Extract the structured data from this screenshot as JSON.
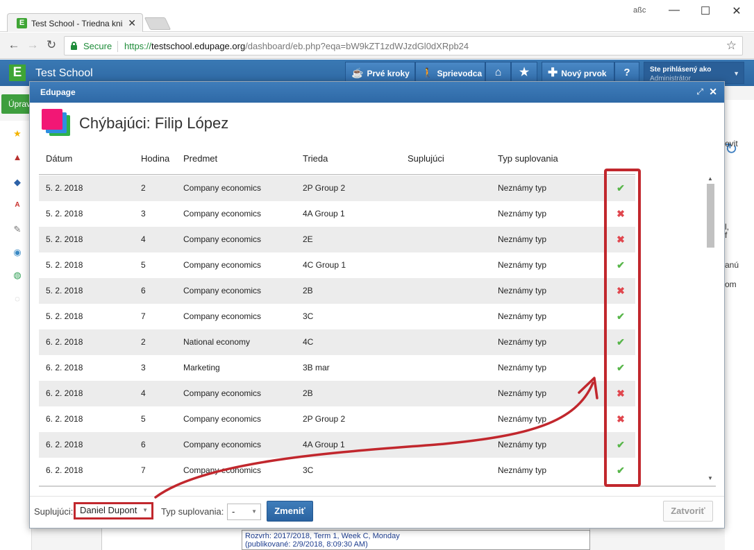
{
  "browser": {
    "tab_title": "Test School - Triedna knižka",
    "tab_favicon": "E",
    "profile_badge": "aßc",
    "secure_label": "Secure",
    "url_scheme": "https://",
    "url_host": "testschool.edupage.org",
    "url_path": "/dashboard/eb.php?eqa=bW9kZT1zdWJzdGl0dXRpb24",
    "icons": [
      "back-arrow-icon",
      "forward-arrow-icon",
      "reload-icon",
      "lock-icon",
      "bookmark-star-icon",
      "close-icon",
      "minimize-icon",
      "maximize-icon"
    ]
  },
  "app": {
    "logo": "E",
    "title": "Test School",
    "buttons": {
      "first_steps": "Prvé kroky",
      "guide": "Sprievodca",
      "new_item": "Nový prvok",
      "help": "?"
    },
    "user": {
      "line1": "Ste prihlásený ako",
      "line2": "Administrátor"
    }
  },
  "background": {
    "upr_button": "Úprav",
    "right_texts": [
      "ovit",
      "l,",
      "f",
      "anú",
      "om"
    ],
    "rozvrh_line1": "Rozvrh: 2017/2018, Term 1, Week C, Monday",
    "rozvrh_line2": "(publikované: 2/9/2018, 8:09:30 AM)"
  },
  "modal": {
    "title": "Edupage",
    "heading": "Chýbajúci: Filip López",
    "columns": {
      "date": "Dátum",
      "lesson": "Hodina",
      "subject": "Predmet",
      "class": "Trieda",
      "substitute": "Suplujúci",
      "type": "Typ suplovania"
    },
    "rows": [
      {
        "date": "5. 2. 2018",
        "lesson": "2",
        "subject": "Company economics",
        "class": "2P Group 2",
        "substitute": "",
        "type": "Neznámy typ",
        "status": "ok"
      },
      {
        "date": "5. 2. 2018",
        "lesson": "3",
        "subject": "Company economics",
        "class": "4A Group 1",
        "substitute": "",
        "type": "Neznámy typ",
        "status": "no"
      },
      {
        "date": "5. 2. 2018",
        "lesson": "4",
        "subject": "Company economics",
        "class": "2E",
        "substitute": "",
        "type": "Neznámy typ",
        "status": "no"
      },
      {
        "date": "5. 2. 2018",
        "lesson": "5",
        "subject": "Company economics",
        "class": "4C Group 1",
        "substitute": "",
        "type": "Neznámy typ",
        "status": "ok"
      },
      {
        "date": "5. 2. 2018",
        "lesson": "6",
        "subject": "Company economics",
        "class": "2B",
        "substitute": "",
        "type": "Neznámy typ",
        "status": "no"
      },
      {
        "date": "5. 2. 2018",
        "lesson": "7",
        "subject": "Company economics",
        "class": "3C",
        "substitute": "",
        "type": "Neznámy typ",
        "status": "ok"
      },
      {
        "date": "6. 2. 2018",
        "lesson": "2",
        "subject": "National economy",
        "class": "4C",
        "substitute": "",
        "type": "Neznámy typ",
        "status": "ok"
      },
      {
        "date": "6. 2. 2018",
        "lesson": "3",
        "subject": "Marketing",
        "class": "3B mar",
        "substitute": "",
        "type": "Neznámy typ",
        "status": "ok"
      },
      {
        "date": "6. 2. 2018",
        "lesson": "4",
        "subject": "Company economics",
        "class": "2B",
        "substitute": "",
        "type": "Neznámy typ",
        "status": "no"
      },
      {
        "date": "6. 2. 2018",
        "lesson": "5",
        "subject": "Company economics",
        "class": "2P Group 2",
        "substitute": "",
        "type": "Neznámy typ",
        "status": "no"
      },
      {
        "date": "6. 2. 2018",
        "lesson": "6",
        "subject": "Company economics",
        "class": "4A Group 1",
        "substitute": "",
        "type": "Neznámy typ",
        "status": "ok"
      },
      {
        "date": "6. 2. 2018",
        "lesson": "7",
        "subject": "Company economics",
        "class": "3C",
        "substitute": "",
        "type": "Neznámy typ",
        "status": "ok"
      }
    ],
    "status_symbols": {
      "ok": "✔",
      "no": "✖"
    },
    "footer": {
      "substitute_label": "Suplujúci:",
      "substitute_value": "Daniel Dupont",
      "type_label": "Typ suplovania:",
      "type_value": "-",
      "change_button": "Zmeniť",
      "close_button": "Zatvoriť"
    }
  },
  "colors": {
    "header_blue": "#2e69a6",
    "ok_green": "#58b64a",
    "no_red": "#e0474e",
    "annotation_red": "#c1272d"
  }
}
